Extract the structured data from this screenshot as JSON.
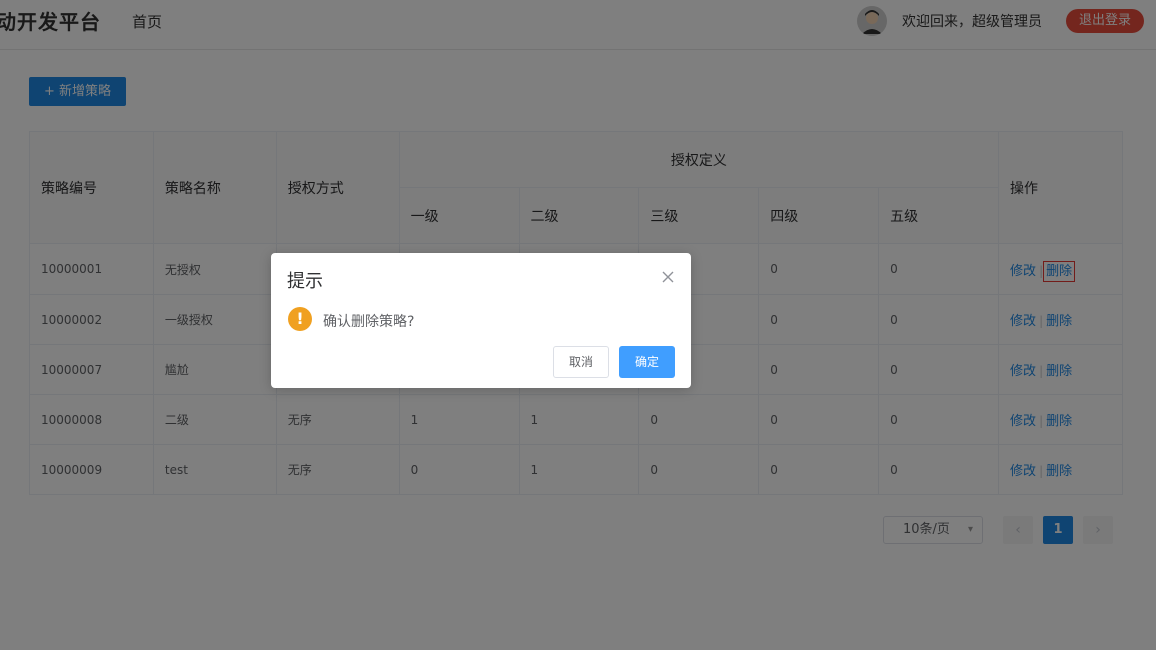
{
  "header": {
    "brand": "动开发平台",
    "nav_home": "首页",
    "welcome": "欢迎回来，超级管理员",
    "logout": "退出登录"
  },
  "toolbar": {
    "add_label": "新增策略"
  },
  "table": {
    "headers": {
      "id": "策略编号",
      "name": "策略名称",
      "method": "授权方式",
      "group": "授权定义",
      "levels": [
        "一级",
        "二级",
        "三级",
        "四级",
        "五级"
      ],
      "ops": "操作"
    },
    "rows": [
      {
        "id": "10000001",
        "name": "无授权",
        "method": "",
        "l1": "",
        "l2": "",
        "l3": "",
        "l4": "0",
        "l5": "0"
      },
      {
        "id": "10000002",
        "name": "一级授权",
        "method": "",
        "l1": "",
        "l2": "",
        "l3": "",
        "l4": "0",
        "l5": "0"
      },
      {
        "id": "10000007",
        "name": "尴尬",
        "method": "",
        "l1": "",
        "l2": "",
        "l3": "",
        "l4": "0",
        "l5": "0"
      },
      {
        "id": "10000008",
        "name": "二级",
        "method": "无序",
        "l1": "1",
        "l2": "1",
        "l3": "0",
        "l4": "0",
        "l5": "0"
      },
      {
        "id": "10000009",
        "name": "test",
        "method": "无序",
        "l1": "0",
        "l2": "1",
        "l3": "0",
        "l4": "0",
        "l5": "0"
      }
    ],
    "edit_label": "修改",
    "delete_label": "删除",
    "separator": "|"
  },
  "pagination": {
    "page_size": "10条/页",
    "current_page": "1",
    "prev": "‹",
    "next": "›"
  },
  "dialog": {
    "title": "提示",
    "message": "确认删除策略?",
    "cancel": "取消",
    "confirm": "确定",
    "icon": "warning-icon"
  },
  "colors": {
    "primary": "#1e88e5",
    "logout": "#e84c3d",
    "warning": "#f0a020"
  }
}
